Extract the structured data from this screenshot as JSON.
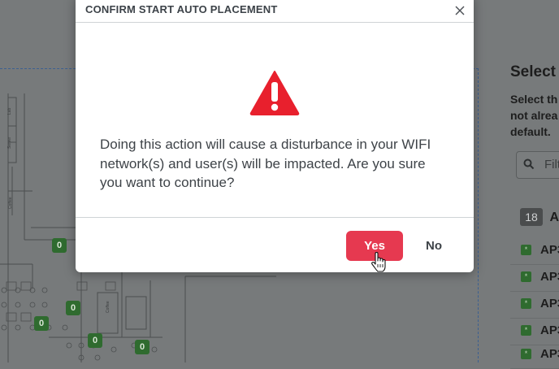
{
  "modal": {
    "title": "CONFIRM START AUTO PLACEMENT",
    "message": "Doing this action will cause a disturbance in your WIFI network(s) and user(s) will be impacted. Are you sure you want to continue?",
    "yes_label": "Yes",
    "no_label": "No",
    "icons": {
      "close": "close-icon",
      "warning": "warning-icon",
      "cursor": "hand-pointer-icon"
    },
    "colors": {
      "primary": "#e63950",
      "warning": "#e8202d",
      "overlay": "#777a7b"
    }
  },
  "background_panel": {
    "title": "Select",
    "description_lines": [
      "Select th",
      "not alrea",
      "default."
    ],
    "filter_placeholder": "Filt",
    "ap_count": "18",
    "ap_count_label": "A",
    "ap_items": [
      {
        "label": "AP3"
      },
      {
        "label": "AP3"
      },
      {
        "label": "AP3"
      },
      {
        "label": "AP3"
      },
      {
        "label": "AP3"
      }
    ]
  },
  "floorplan": {
    "room_labels": [
      "Lab",
      "Server",
      "Coffee",
      "Coffee"
    ],
    "ap_markers": [
      {
        "count": "0"
      },
      {
        "count": "0"
      },
      {
        "count": "0"
      },
      {
        "count": "0"
      },
      {
        "count": "0"
      }
    ]
  }
}
